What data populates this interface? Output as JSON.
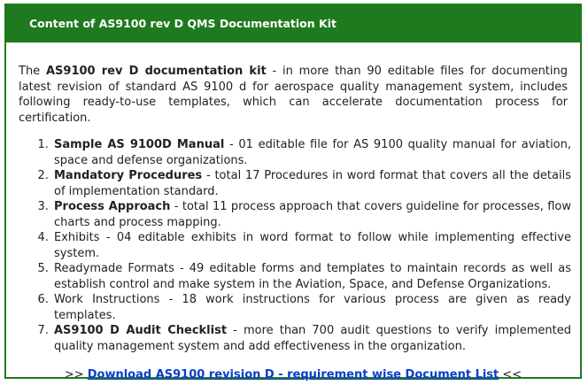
{
  "header": {
    "title": "Content of AS9100 rev D QMS Documentation Kit"
  },
  "intro": {
    "prefix": "The ",
    "bold": "AS9100 rev D documentation kit",
    "rest": " - in more than 90 editable files for documenting latest revision of standard AS 9100 d for aerospace quality management system, includes following ready-to-use templates, which can accelerate documentation process for certification."
  },
  "items": [
    {
      "bold": "Sample AS 9100D Manual",
      "text": " - 01 editable file for AS 9100 quality manual for aviation, space and defense organizations."
    },
    {
      "bold": "Mandatory Procedures",
      "text": " - total 17 Procedures in word format that covers all the details of implementation standard."
    },
    {
      "bold": "Process Approach",
      "text": " - total 11 process approach that covers guideline for processes, flow charts and process mapping."
    },
    {
      "bold": "",
      "text": "Exhibits - 04 editable exhibits in word format to follow while implementing effective system."
    },
    {
      "bold": "",
      "text": "Readymade Formats - 49 editable forms and templates to maintain records as well as establish control and make system in the Aviation, Space, and Defense Organizations."
    },
    {
      "bold": "",
      "text": "Work Instructions - 18 work instructions for various process are given as ready templates."
    },
    {
      "bold": "AS9100 D Audit Checklist",
      "text": " - more than 700 audit questions to verify implemented quality management system and add effectiveness in the organization."
    }
  ],
  "footer": {
    "prefix": ">> ",
    "link_text": "Download AS9100 revision D - requirement wise Document List",
    "suffix": " <<"
  }
}
